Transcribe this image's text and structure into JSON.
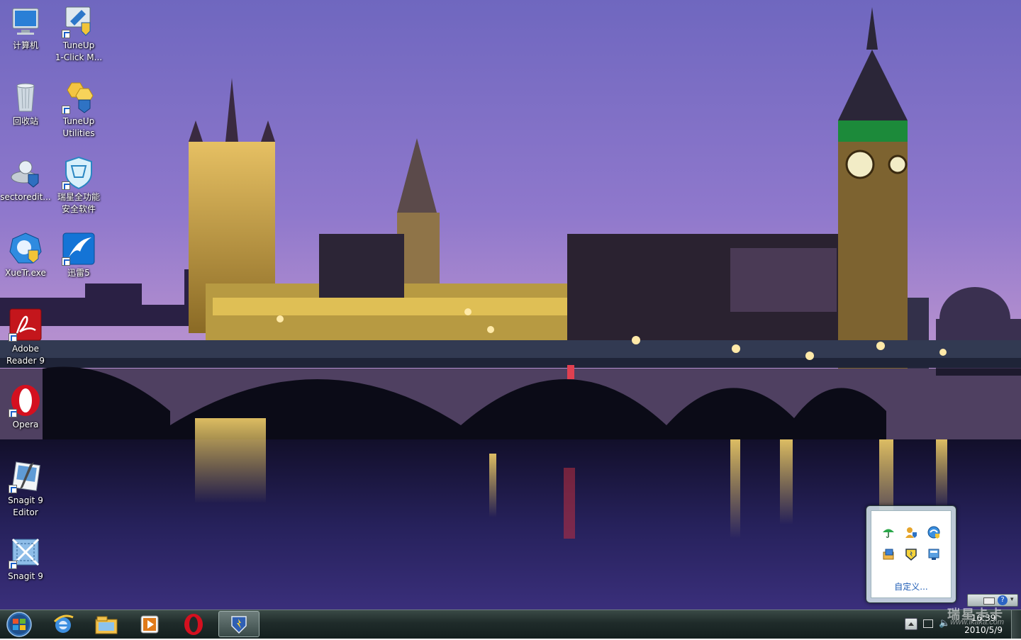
{
  "desktop": {
    "icons": [
      {
        "label": "计算机",
        "icon": "computer-icon"
      },
      {
        "label": "TuneUp\n1-Click M...",
        "icon": "tuneup-1click-icon"
      },
      {
        "label": "回收站",
        "icon": "recycle-bin-icon"
      },
      {
        "label": "TuneUp\nUtilities",
        "icon": "tuneup-utilities-icon"
      },
      {
        "label": "sectoredit...",
        "icon": "sectoredit-icon"
      },
      {
        "label": "瑞星全功能\n安全软件",
        "icon": "rising-security-icon"
      },
      {
        "label": "XueTr.exe",
        "icon": "xuetr-icon"
      },
      {
        "label": "迅雷5",
        "icon": "thunder-icon"
      },
      {
        "label": "Adobe\nReader 9",
        "icon": "adobe-reader-icon"
      },
      {
        "label": "Opera",
        "icon": "opera-icon"
      },
      {
        "label": "Snagit 9\nEditor",
        "icon": "snagit-editor-icon"
      },
      {
        "label": "Snagit 9",
        "icon": "snagit-icon"
      }
    ]
  },
  "taskbar": {
    "start": "start-orb-icon",
    "pinned": [
      {
        "name": "internet-explorer-icon"
      },
      {
        "name": "windows-explorer-icon"
      },
      {
        "name": "media-player-icon"
      },
      {
        "name": "opera-icon"
      },
      {
        "name": "rising-shield-icon"
      }
    ],
    "clock": {
      "time": "16:39",
      "date": "2010/5/9"
    },
    "watermark": {
      "text": "瑞星卡卡",
      "url": "www.ikaka.com"
    }
  },
  "tray_popup": {
    "icons": [
      "umbrella-icon",
      "user-shield-icon",
      "globe-refresh-icon",
      "folder-arrow-icon",
      "rising-shield-icon",
      "monitor-window-icon"
    ],
    "customize_link": "自定义..."
  },
  "colors": {
    "sky_top": "#7a6fc4",
    "sky_bottom": "#b48fcf",
    "river": "#1d1a4a",
    "taskbar": "#1f2b2a",
    "link": "#1c5bb4"
  }
}
